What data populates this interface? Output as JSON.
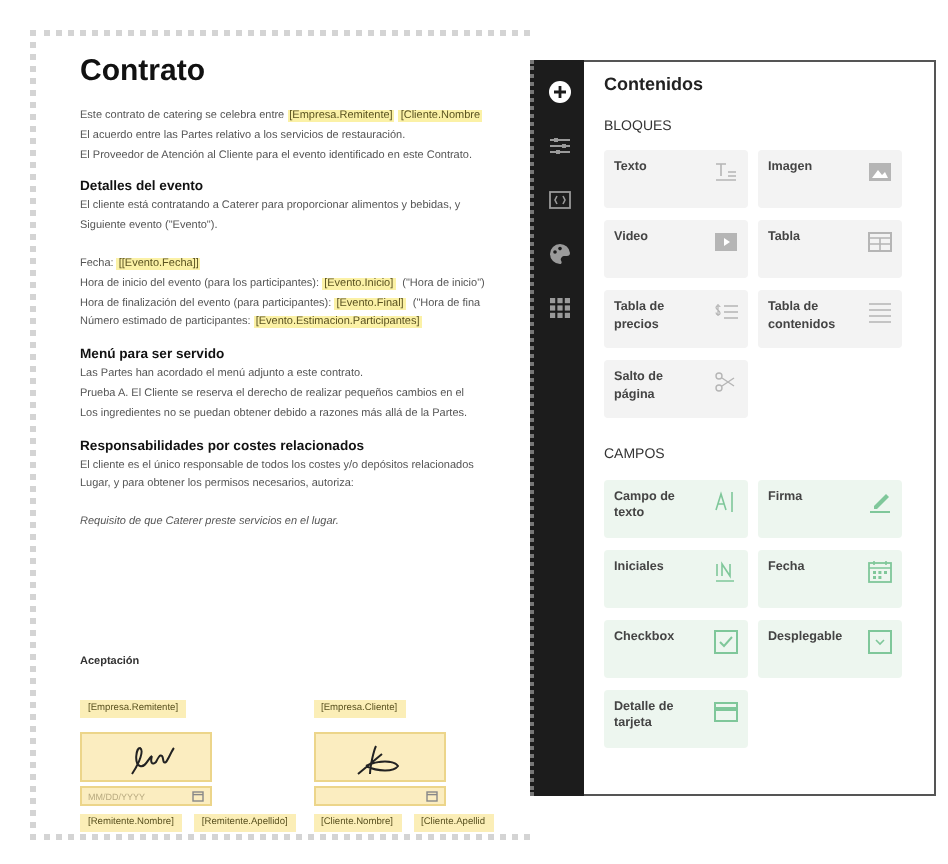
{
  "document": {
    "title": "Contrato",
    "sections": [
      {
        "lines": [
          {
            "segments": [
              {
                "kind": "text",
                "text": "Este contrato de catering se celebra entre "
              },
              {
                "kind": "field",
                "text": "[Empresa.Remitente]"
              },
              {
                "kind": "field",
                "text": "[Cliente.Nombre"
              }
            ]
          },
          {
            "segments": [
              {
                "kind": "text",
                "text": "El acuerdo entre las Partes relativo a los servicios de restauración."
              }
            ]
          },
          {
            "segments": [
              {
                "kind": "text",
                "text": "El Proveedor de Atención al Cliente para el evento identificado en este Contrato."
              }
            ]
          }
        ]
      },
      {
        "heading": "Detalles del evento",
        "lines": [
          {
            "segments": [
              {
                "kind": "text",
                "text": "El cliente está contratando a Caterer para proporcionar alimentos y bebidas, y"
              }
            ]
          },
          {
            "segments": [
              {
                "kind": "text",
                "text": "Siguiente evento (\"Evento\")."
              }
            ]
          },
          {
            "gap_before": true,
            "segments": [
              {
                "kind": "text",
                "text": "Fecha: "
              },
              {
                "kind": "field",
                "text": "[[Evento.Fecha]]"
              }
            ]
          },
          {
            "segments": [
              {
                "kind": "text",
                "text": "Hora de inicio del evento (para los participantes): "
              },
              {
                "kind": "field",
                "text": "[Evento.Inicio]"
              },
              {
                "kind": "text",
                "text": " (\"Hora de inicio\")"
              }
            ]
          },
          {
            "segments": [
              {
                "kind": "text",
                "text": "Hora de finalización del evento (para participantes): "
              },
              {
                "kind": "field",
                "text": "[Evento.Final]"
              },
              {
                "kind": "text",
                "text": " (\"Hora de fina"
              }
            ]
          },
          {
            "segments": [
              {
                "kind": "text",
                "text": "Número estimado de participantes: "
              },
              {
                "kind": "field",
                "text": "[Evento.Estimacion.Participantes]"
              }
            ]
          }
        ]
      },
      {
        "heading": "Menú para ser servido",
        "lines": [
          {
            "segments": [
              {
                "kind": "text",
                "text": "Las Partes han acordado el menú adjunto a este contrato."
              }
            ]
          },
          {
            "segments": [
              {
                "kind": "text",
                "text": "Prueba A. El Cliente se reserva el derecho de realizar pequeños cambios en el"
              }
            ]
          },
          {
            "segments": [
              {
                "kind": "text",
                "text": "Los ingredientes no se puedan obtener debido a razones más allá de la Partes."
              }
            ]
          }
        ]
      },
      {
        "heading": "Responsabilidades por costes relacionados",
        "lines": [
          {
            "segments": [
              {
                "kind": "text",
                "text": "El cliente es el único responsable de todos los costes y/o depósitos relacionados"
              }
            ]
          },
          {
            "segments": [
              {
                "kind": "text",
                "text": "Lugar, y para obtener los permisos necesarios, autoriza:"
              }
            ]
          },
          {
            "gap_before": true,
            "italic": true,
            "segments": [
              {
                "kind": "text",
                "text": "Requisito de que Caterer preste servicios en el lugar."
              }
            ]
          }
        ]
      }
    ],
    "acceptance": {
      "label": "Aceptación",
      "signers": [
        {
          "company": "[Empresa.Remitente]",
          "date_placeholder": "MM/DD/YYYY",
          "names": [
            "[Remitente.Nombre]",
            "[Remitente.Apellido]"
          ]
        },
        {
          "company": "[Empresa.Cliente]",
          "names": [
            "[Cliente.Nombre]",
            "[Cliente.Apellid"
          ]
        }
      ]
    }
  },
  "sidebar": {
    "items": [
      {
        "kind": "add",
        "selected": true
      },
      {
        "kind": "settings",
        "selected": false
      },
      {
        "kind": "code",
        "selected": false
      },
      {
        "kind": "palette",
        "selected": false
      },
      {
        "kind": "grid",
        "selected": false
      }
    ]
  },
  "panel": {
    "title": "Contenidos",
    "groups": [
      {
        "kind": "block",
        "heading": "BLOQUES",
        "items": [
          {
            "label": "Texto",
            "kind": "text"
          },
          {
            "label": "Imagen",
            "kind": "image"
          },
          {
            "label": "Video",
            "kind": "video"
          },
          {
            "label": "Tabla",
            "kind": "table"
          },
          {
            "label": "Tabla de precios",
            "kind": "pricing"
          },
          {
            "label": "Tabla de contenidos",
            "kind": "toc"
          },
          {
            "label": "Salto de página",
            "kind": "pagebreak"
          }
        ]
      },
      {
        "kind": "field",
        "heading": "CAMPOS",
        "items": [
          {
            "label": "Campo de texto",
            "kind": "textfield"
          },
          {
            "label": "Firma",
            "kind": "signature"
          },
          {
            "label": "Iniciales",
            "kind": "initials"
          },
          {
            "label": "Fecha",
            "kind": "date"
          },
          {
            "label": "Checkbox",
            "kind": "checkbox"
          },
          {
            "label": "Desplegable",
            "kind": "dropdown"
          },
          {
            "label": "Detalle de tarjeta",
            "kind": "card"
          }
        ]
      }
    ]
  }
}
